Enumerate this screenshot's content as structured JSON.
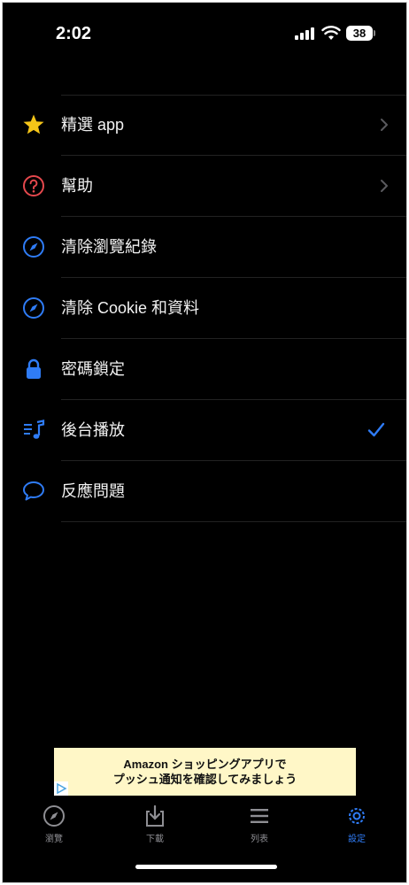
{
  "status_bar": {
    "time": "2:02",
    "battery_level": "38"
  },
  "menu": {
    "items": [
      {
        "label": "精選 app",
        "icon": "star-icon",
        "accessory": "chevron"
      },
      {
        "label": "幫助",
        "icon": "help-circle-icon",
        "accessory": "chevron"
      },
      {
        "label": "清除瀏覽紀錄",
        "icon": "compass-icon",
        "accessory": "none"
      },
      {
        "label": "清除 Cookie 和資料",
        "icon": "compass-icon",
        "accessory": "none"
      },
      {
        "label": "密碼鎖定",
        "icon": "lock-icon",
        "accessory": "none"
      },
      {
        "label": "後台播放",
        "icon": "music-list-icon",
        "accessory": "checkmark"
      },
      {
        "label": "反應問題",
        "icon": "speech-bubble-icon",
        "accessory": "none"
      }
    ]
  },
  "ad": {
    "line1": "Amazon ショッピングアプリで",
    "line2": "プッシュ通知を確認してみましょう"
  },
  "tabbar": {
    "tabs": [
      {
        "label": "瀏覽",
        "icon": "compass-icon",
        "active": false
      },
      {
        "label": "下載",
        "icon": "download-icon",
        "active": false
      },
      {
        "label": "列表",
        "icon": "list-icon",
        "active": false
      },
      {
        "label": "設定",
        "icon": "gear-icon",
        "active": true
      }
    ]
  },
  "colors": {
    "accent_blue": "#2f7cf6",
    "star_yellow": "#f5c518",
    "help_red": "#e5484d",
    "background": "#000000",
    "ad_background": "#fff7c7"
  }
}
